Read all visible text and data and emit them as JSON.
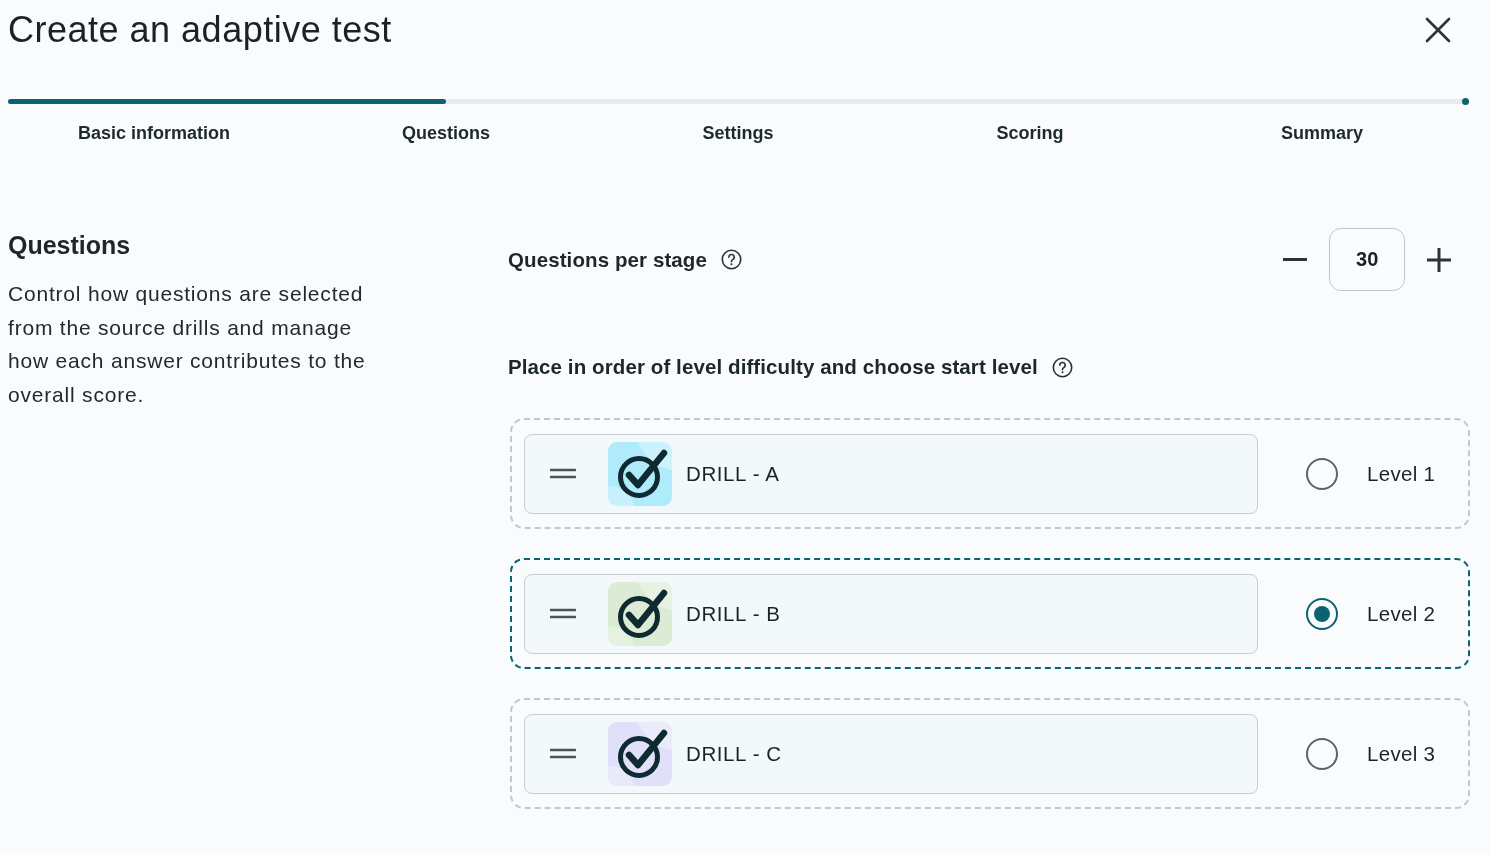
{
  "dialog": {
    "title": "Create an adaptive test"
  },
  "progress": {
    "level": 0.3
  },
  "steps": [
    {
      "label": "Basic information"
    },
    {
      "label": "Questions"
    },
    {
      "label": "Settings"
    },
    {
      "label": "Scoring"
    },
    {
      "label": "Summary"
    }
  ],
  "section": {
    "heading": "Questions",
    "description": "Control how questions are selected from the source drills and manage how each answer contributes to the overall score."
  },
  "questions_per_stage": {
    "label": "Questions per stage",
    "value": "30"
  },
  "order": {
    "label": "Place in order of level difficulty and choose start level"
  },
  "drills": [
    {
      "name": "DRILL - A",
      "color": "#b0ebfc",
      "level_label": "Level 1",
      "selected": false
    },
    {
      "name": "DRILL - B",
      "color": "#dcebd3",
      "level_label": "Level 2",
      "selected": true
    },
    {
      "name": "DRILL - C",
      "color": "#e0e0fb",
      "level_label": "Level 3",
      "selected": false
    }
  ]
}
